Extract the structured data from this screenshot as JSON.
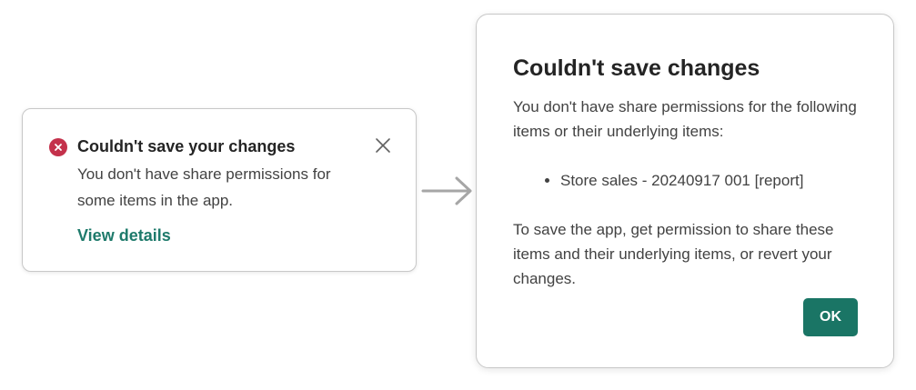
{
  "colors": {
    "error_red": "#c4314b",
    "link_teal": "#1e7a6b",
    "primary_button": "#1a7565",
    "arrow_gray": "#a6a6a6"
  },
  "toast": {
    "status_icon": "error-circle-icon",
    "title": "Couldn't save your changes",
    "message": "You don't have share permissions for some items in the app.",
    "close_icon": "close-icon",
    "link_label": "View details"
  },
  "arrow_icon": "right-arrow-icon",
  "dialog": {
    "title": "Couldn't save changes",
    "intro": "You don't have share permissions for the following items or their underlying items:",
    "items": [
      "Store sales - 20240917 001 [report]"
    ],
    "footer_text": "To save the app, get permission to share these items and their underlying items, or revert your changes.",
    "ok_label": "OK"
  }
}
